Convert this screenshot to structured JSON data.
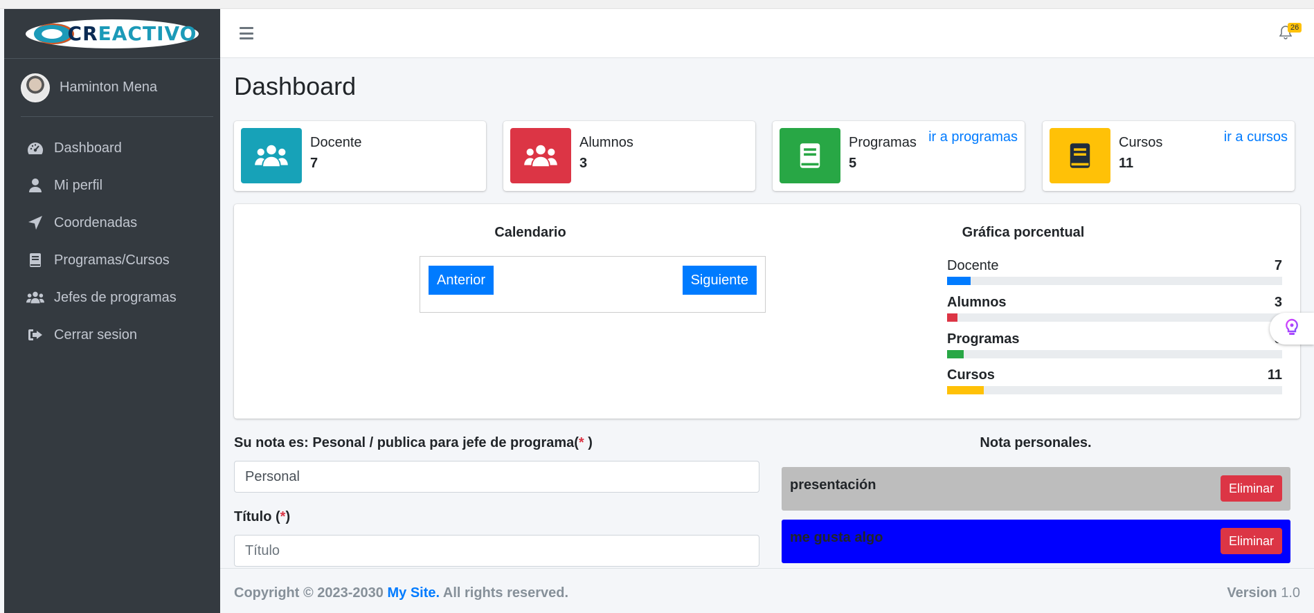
{
  "brand": {
    "logo_text_1": "CR",
    "logo_text_2": "EACTIVO"
  },
  "user": {
    "name": "Haminton Mena"
  },
  "sidebar": {
    "items": [
      {
        "label": "Dashboard",
        "icon": "tachometer-icon"
      },
      {
        "label": "Mi perfil",
        "icon": "user-icon"
      },
      {
        "label": "Coordenadas",
        "icon": "paper-plane-icon"
      },
      {
        "label": "Programas/Cursos",
        "icon": "book-icon"
      },
      {
        "label": "Jefes de programas",
        "icon": "users-icon"
      },
      {
        "label": "Cerrar sesion",
        "icon": "sign-out-icon"
      }
    ]
  },
  "header": {
    "notifications_count": "26"
  },
  "page": {
    "title": "Dashboard"
  },
  "stats": [
    {
      "label": "Docente",
      "value": "7",
      "color": "#17a2b8",
      "icon": "users-icon"
    },
    {
      "label": "Alumnos",
      "value": "3",
      "color": "#dc3545",
      "icon": "users-icon"
    },
    {
      "label": "Programas",
      "value": "5",
      "color": "#28a745",
      "icon": "book-icon",
      "link": "ir a programas"
    },
    {
      "label": "Cursos",
      "value": "11",
      "color": "#ffc107",
      "icon": "book-icon",
      "link": "ir a cursos"
    }
  ],
  "calendar": {
    "title": "Calendario",
    "prev_label": "Anterior",
    "next_label": "Siguiente"
  },
  "graph": {
    "title": "Gráfica porcentual",
    "rows": [
      {
        "label": "Docente",
        "value": "7",
        "percent": 7,
        "color": "#007bff"
      },
      {
        "label": "Alumnos",
        "value": "3",
        "percent": 3,
        "color": "#dc3545"
      },
      {
        "label": "Programas",
        "value": "5",
        "percent": 5,
        "color": "#28a745"
      },
      {
        "label": "Cursos",
        "value": "11",
        "percent": 11,
        "color": "#ffc107"
      }
    ]
  },
  "form": {
    "note_type_label": "Su nota es: Pesonal / publica para jefe de programa(",
    "note_type_required": "*",
    "note_type_close": " )",
    "note_type_value": "Personal",
    "title_label": "Título (",
    "title_required": "*",
    "title_close": ")",
    "title_placeholder": "Título"
  },
  "notes": {
    "title": "Nota personales.",
    "items": [
      {
        "title": "presentación",
        "color": "#bdbdbd",
        "delete_label": "Eliminar"
      },
      {
        "title": "me gusta algo",
        "color": "#0000ff",
        "delete_label": "Eliminar"
      }
    ]
  },
  "footer": {
    "copyright_prefix": "Copyright © 2023-2030 ",
    "site_name": "My Site.",
    "rights": " All rights reserved.",
    "version_label": "Version",
    "version_number": " 1.0"
  }
}
